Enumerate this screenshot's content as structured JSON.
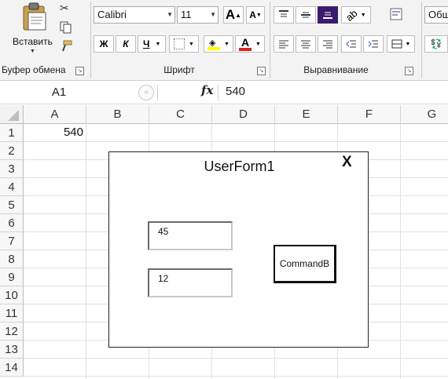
{
  "ribbon": {
    "clipboard": {
      "paste_label": "Вставить",
      "group_label": "Буфер обмена"
    },
    "font": {
      "font_name": "Calibri",
      "font_size": "11",
      "grow_label": "A",
      "shrink_label": "A",
      "bold": "Ж",
      "italic": "К",
      "underline": "Ч",
      "font_color_label": "A",
      "group_label": "Шрифт"
    },
    "alignment": {
      "group_label": "Выравнивание"
    },
    "number": {
      "format_label": "Общ"
    }
  },
  "formula_bar": {
    "name_box": "A1",
    "fx": "fx",
    "value": "540"
  },
  "grid": {
    "columns": [
      "A",
      "B",
      "C",
      "D",
      "E",
      "F",
      "G"
    ],
    "rows": [
      "1",
      "2",
      "3",
      "4",
      "5",
      "6",
      "7",
      "8",
      "9",
      "10",
      "11",
      "12",
      "13",
      "14"
    ],
    "cells": {
      "A1": "540"
    }
  },
  "userform": {
    "title": "UserForm1",
    "close": "X",
    "textbox1": "45",
    "textbox2": "12",
    "command_button": "CommandB"
  },
  "colors": {
    "accent": "#3b1b6e",
    "font_color_bar": "#e02020",
    "highlight_bar": "#ffff00"
  }
}
